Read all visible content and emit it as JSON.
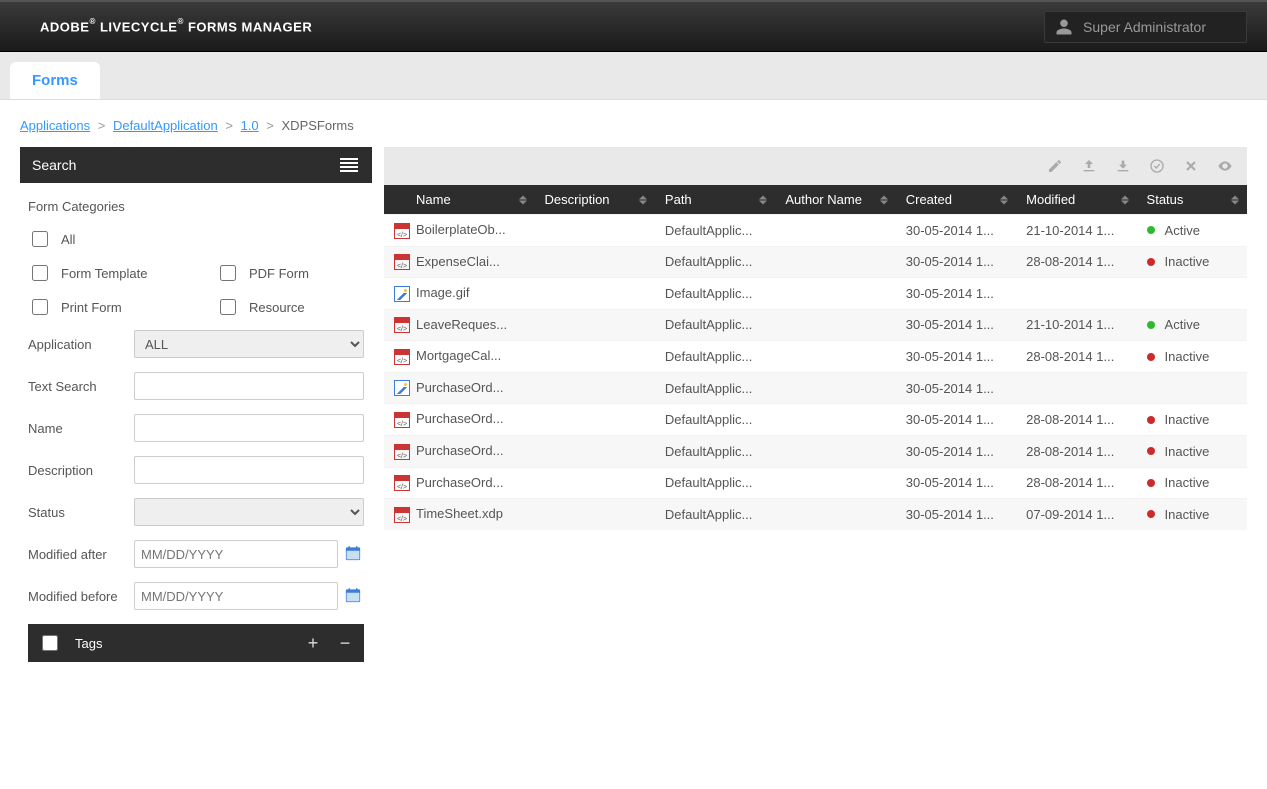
{
  "header": {
    "brand1": "ADOBE",
    "brand2": "LIVECYCLE",
    "brand3": "FORMS MANAGER",
    "user": "Super Administrator"
  },
  "tab": {
    "label": "Forms"
  },
  "breadcrumbs": {
    "items": [
      "Applications",
      "DefaultApplication",
      "1.0"
    ],
    "current": "XDPSForms"
  },
  "search": {
    "title": "Search",
    "categories_label": "Form Categories",
    "cb_all": "All",
    "cb_template": "Form Template",
    "cb_pdf": "PDF Form",
    "cb_print": "Print Form",
    "cb_resource": "Resource",
    "labels": {
      "application": "Application",
      "text": "Text Search",
      "name": "Name",
      "description": "Description",
      "status": "Status",
      "modafter": "Modified after",
      "modbefore": "Modified before"
    },
    "application_value": "ALL",
    "date_placeholder": "MM/DD/YYYY",
    "tags_label": "Tags"
  },
  "columns": {
    "name": "Name",
    "description": "Description",
    "path": "Path",
    "author": "Author Name",
    "created": "Created",
    "modified": "Modified",
    "status": "Status"
  },
  "rows": [
    {
      "icon": "pdf",
      "name": "BoilerplateOb...",
      "desc": "",
      "path": "DefaultApplic...",
      "author": "",
      "created": "30-05-2014 1...",
      "modified": "21-10-2014 1...",
      "status": "Active",
      "dot": "green"
    },
    {
      "icon": "pdf",
      "name": "ExpenseClai...",
      "desc": "",
      "path": "DefaultApplic...",
      "author": "",
      "created": "30-05-2014 1...",
      "modified": "28-08-2014 1...",
      "status": "Inactive",
      "dot": "red"
    },
    {
      "icon": "img",
      "name": "Image.gif",
      "desc": "",
      "path": "DefaultApplic...",
      "author": "",
      "created": "30-05-2014 1...",
      "modified": "",
      "status": "",
      "dot": ""
    },
    {
      "icon": "pdf",
      "name": "LeaveReques...",
      "desc": "",
      "path": "DefaultApplic...",
      "author": "",
      "created": "30-05-2014 1...",
      "modified": "21-10-2014 1...",
      "status": "Active",
      "dot": "green"
    },
    {
      "icon": "pdf",
      "name": "MortgageCal...",
      "desc": "",
      "path": "DefaultApplic...",
      "author": "",
      "created": "30-05-2014 1...",
      "modified": "28-08-2014 1...",
      "status": "Inactive",
      "dot": "red"
    },
    {
      "icon": "img",
      "name": "PurchaseOrd...",
      "desc": "",
      "path": "DefaultApplic...",
      "author": "",
      "created": "30-05-2014 1...",
      "modified": "",
      "status": "",
      "dot": ""
    },
    {
      "icon": "pdf",
      "name": "PurchaseOrd...",
      "desc": "",
      "path": "DefaultApplic...",
      "author": "",
      "created": "30-05-2014 1...",
      "modified": "28-08-2014 1...",
      "status": "Inactive",
      "dot": "red"
    },
    {
      "icon": "pdf",
      "name": "PurchaseOrd...",
      "desc": "",
      "path": "DefaultApplic...",
      "author": "",
      "created": "30-05-2014 1...",
      "modified": "28-08-2014 1...",
      "status": "Inactive",
      "dot": "red"
    },
    {
      "icon": "pdf",
      "name": "PurchaseOrd...",
      "desc": "",
      "path": "DefaultApplic...",
      "author": "",
      "created": "30-05-2014 1...",
      "modified": "28-08-2014 1...",
      "status": "Inactive",
      "dot": "red"
    },
    {
      "icon": "pdf",
      "name": "TimeSheet.xdp",
      "desc": "",
      "path": "DefaultApplic...",
      "author": "",
      "created": "30-05-2014 1...",
      "modified": "07-09-2014 1...",
      "status": "Inactive",
      "dot": "red"
    }
  ]
}
